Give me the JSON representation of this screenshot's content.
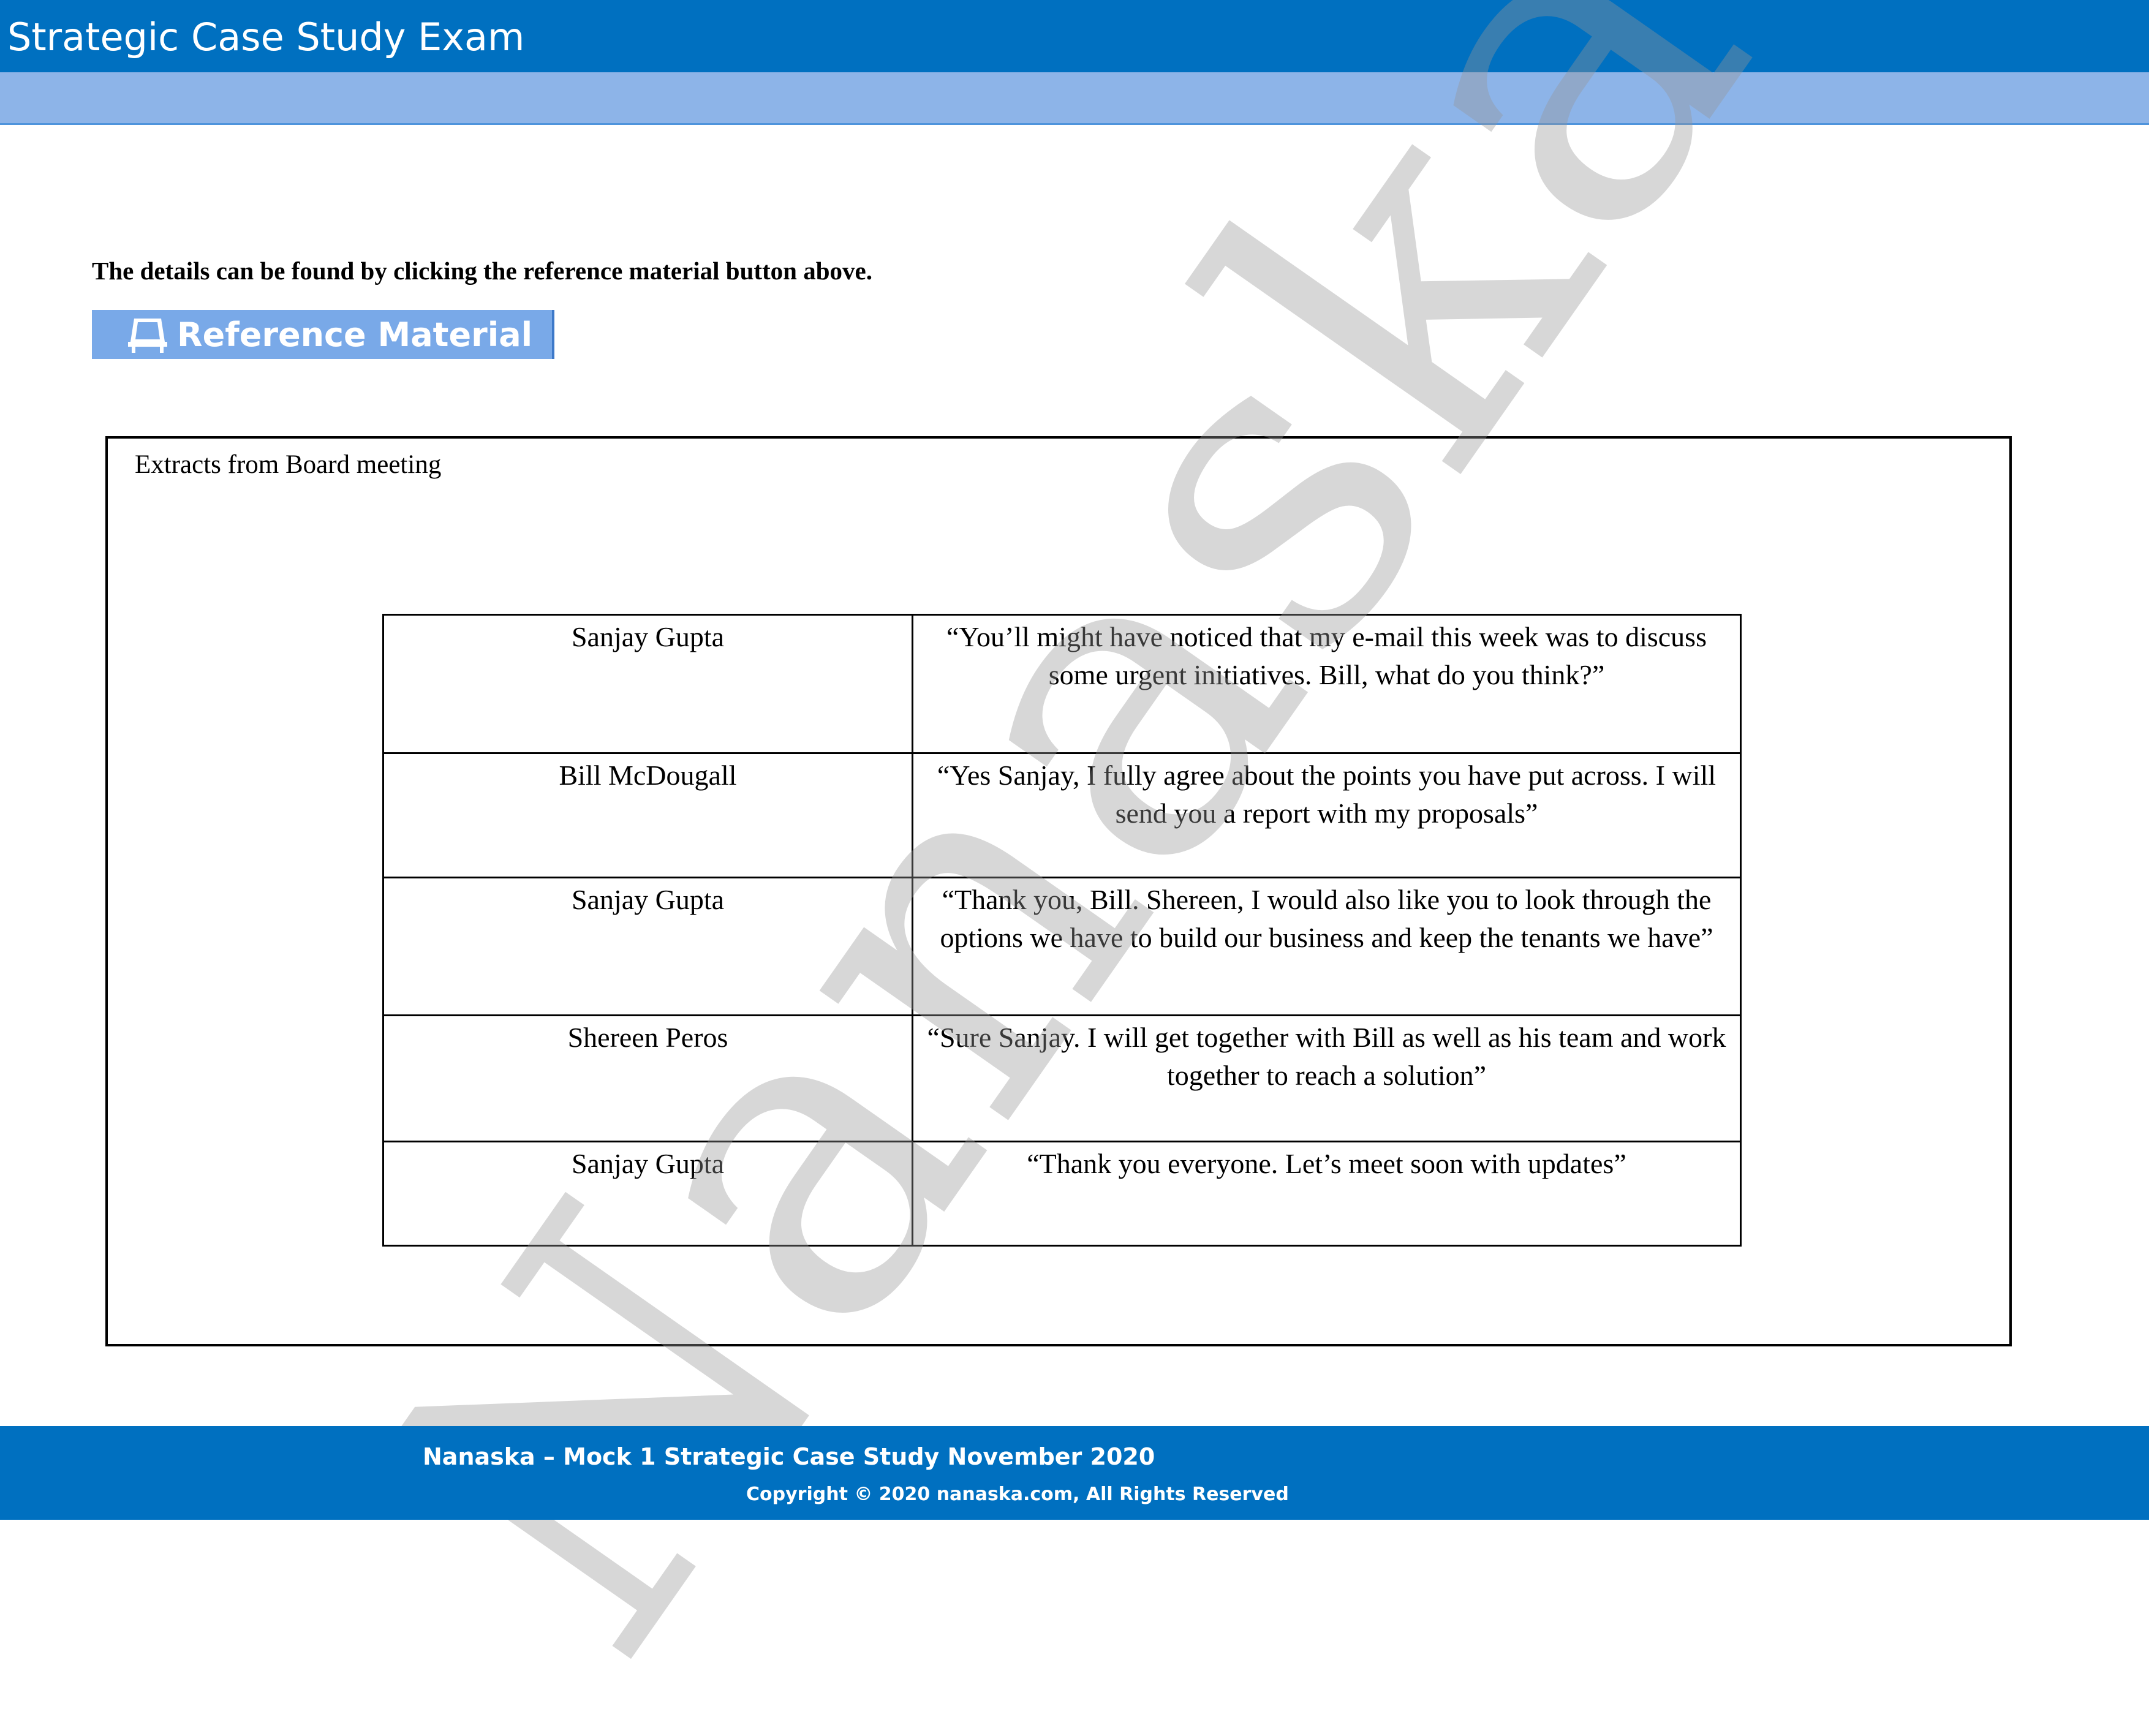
{
  "header": {
    "title": "Strategic Case Study Exam"
  },
  "instruction": "The details can be found by clicking the reference material button above.",
  "reference_button": {
    "label": "Reference Material",
    "icon": "book-stand-icon"
  },
  "extract_box": {
    "title": "Extracts from Board meeting",
    "rows": [
      {
        "speaker": "Sanjay Gupta",
        "quote": "“You’ll might have noticed that my e-mail this week was to discuss some urgent initiatives. Bill, what do you think?”"
      },
      {
        "speaker": "Bill McDougall",
        "quote": "“Yes Sanjay, I fully agree about the points you have put across. I will send you a report with my proposals”"
      },
      {
        "speaker": "Sanjay Gupta",
        "quote": "“Thank you, Bill. Shereen, I would also like you to look through the options we have to build our business and keep the tenants we have”"
      },
      {
        "speaker": "Shereen Peros",
        "quote": "“Sure Sanjay. I will get together with Bill as well as his team and work together to reach a solution”"
      },
      {
        "speaker": "Sanjay Gupta",
        "quote": "“Thank you everyone. Let’s meet soon with updates”"
      }
    ]
  },
  "watermark": "Nanaska",
  "footer": {
    "line1": "Nanaska – Mock 1 Strategic Case Study November 2020",
    "line2": "Copyright © 2020 nanaska.com, All Rights Reserved"
  },
  "colors": {
    "header": "#0070c0",
    "subheader": "#8db4e8",
    "button": "#79a9e8",
    "footer": "#0070c0"
  }
}
